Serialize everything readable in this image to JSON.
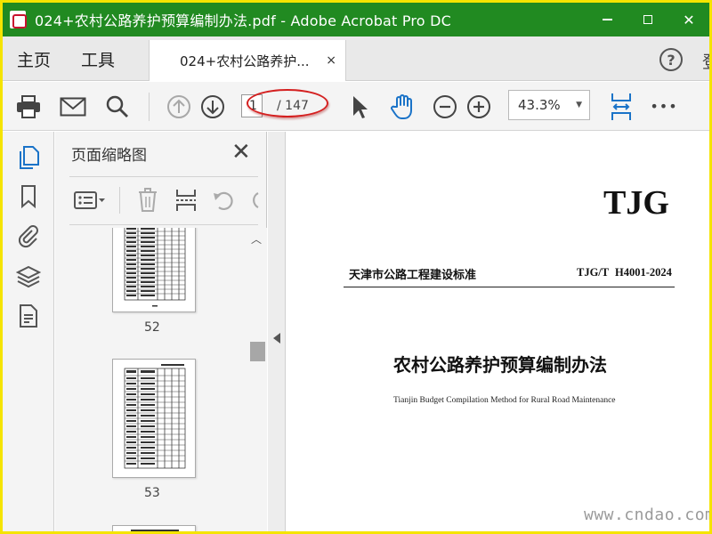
{
  "window": {
    "title": "024+农村公路养护预算编制办法.pdf - Adobe Acrobat Pro DC",
    "minimize": "—",
    "close": "✕"
  },
  "menu": {
    "home": "主页",
    "tools": "工具",
    "doc_tab": "024+农村公路养护...",
    "tab_close": "×",
    "help": "?",
    "cutoff": "登"
  },
  "toolbar": {
    "page_current": "1",
    "page_total": "/ 147",
    "zoom": "43.3%",
    "more": "•••"
  },
  "panel": {
    "title": "页面缩略图",
    "close": "✕",
    "thumbnails": [
      {
        "label": "52"
      },
      {
        "label": "53"
      }
    ]
  },
  "document": {
    "brand": "TJG",
    "standard_name": "天津市公路工程建设标准",
    "standard_code": "TJG/T  H4001-2024",
    "title": "农村公路养护预算编制办法",
    "subtitle": "Tianjin Budget Compilation Method for Rural Road Maintenance"
  },
  "watermark": "www.cndao.com",
  "colors": {
    "titlebar": "#218a21",
    "frame": "#f5e400",
    "accent_blue": "#1a73c8",
    "annotation_red": "#d42020"
  }
}
